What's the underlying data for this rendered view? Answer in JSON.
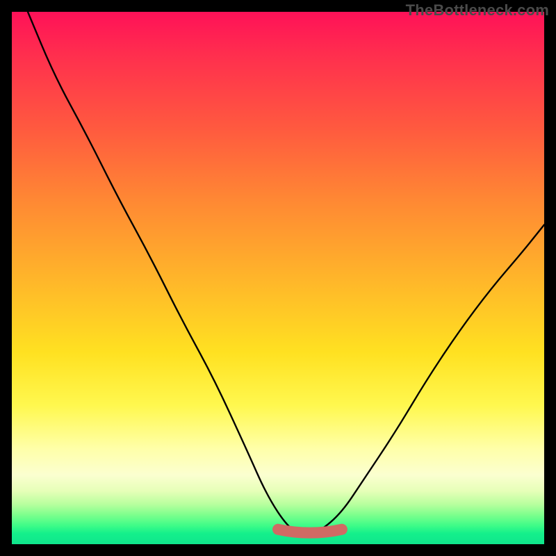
{
  "watermark": "TheBottleneck.com",
  "colors": {
    "curve": "#000000",
    "valley_highlight": "#d06a64",
    "frame_bg": "#000000"
  },
  "chart_data": {
    "type": "line",
    "title": "",
    "xlabel": "",
    "ylabel": "",
    "xlim": [
      0,
      100
    ],
    "ylim": [
      0,
      100
    ],
    "series": [
      {
        "name": "bottleneck-curve",
        "x": [
          3,
          8,
          14,
          20,
          26,
          32,
          38,
          44,
          48,
          52,
          55,
          58,
          62,
          66,
          72,
          78,
          84,
          90,
          96,
          100
        ],
        "y": [
          100,
          88,
          77,
          65,
          54,
          42,
          31,
          18,
          9,
          3,
          1.5,
          2.5,
          6,
          12,
          21,
          31,
          40,
          48,
          55,
          60
        ]
      }
    ],
    "annotations": [
      {
        "name": "valley-floor",
        "x_range": [
          50,
          62
        ],
        "y": 2,
        "color": "#d06a64"
      }
    ]
  }
}
